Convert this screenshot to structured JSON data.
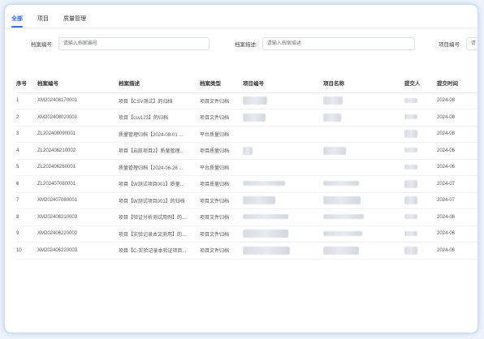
{
  "tabs": [
    {
      "label": "全部",
      "active": true
    },
    {
      "label": "项目",
      "active": false
    },
    {
      "label": "质量管理",
      "active": false
    }
  ],
  "filters": {
    "archive_no": {
      "label": "档案编号:",
      "placeholder": "请输入档案编号"
    },
    "archive_desc": {
      "label": "档案描述:",
      "placeholder": "请输入档案描述"
    },
    "project_no": {
      "label": "项目编号:",
      "placeholder": "请"
    }
  },
  "table": {
    "columns": [
      "序号",
      "档案编号",
      "档案描述",
      "档案类型",
      "项目编号",
      "项目名称",
      "提交人",
      "提交时间"
    ],
    "rows": [
      {
        "idx": "1",
        "no": "XM202408170001",
        "desc": "项目【CSV测试】的归档",
        "type": "项目文件归档",
        "date": "2024-08"
      },
      {
        "idx": "2",
        "no": "XM202408020001",
        "desc": "项目【csv123】的归档",
        "type": "项目文件归档",
        "date": "2024-08"
      },
      {
        "idx": "3",
        "no": "ZL202408090001",
        "desc": "质量管理归档【2024-08-01 ...",
        "type": "平台质量归档",
        "date": "2024-08"
      },
      {
        "idx": "4",
        "no": "ZL202406210002",
        "desc": "项目【启航项目2】质量管理...",
        "type": "项目质量归档",
        "date": "2024-06"
      },
      {
        "idx": "5",
        "no": "ZL202406260001",
        "desc": "质量管理归档【2024-06-26 ...",
        "type": "平台质量归档",
        "date": "2024-06"
      },
      {
        "idx": "6",
        "no": "ZL202407080001",
        "desc": "项目【W测试项目001】质量...",
        "type": "项目质量归档",
        "date": "2024-07"
      },
      {
        "idx": "7",
        "no": "XM202407080001",
        "desc": "项目【W测试项目001】的归档",
        "type": "项目文件归档",
        "date": "2024-07"
      },
      {
        "idx": "8",
        "no": "XM202406210003",
        "desc": "项目【验证分析测试用例】的...",
        "type": "项目文件归档",
        "date": "2024-06"
      },
      {
        "idx": "9",
        "no": "XM202406220002",
        "desc": "项目【实验记录本文测用】的...",
        "type": "项目文件归档",
        "date": "2024-06"
      },
      {
        "idx": "10",
        "no": "XM202406220003",
        "desc": "项目【C-实验记录本验证项目...",
        "type": "项目文件归档",
        "date": "2024-06"
      }
    ]
  }
}
